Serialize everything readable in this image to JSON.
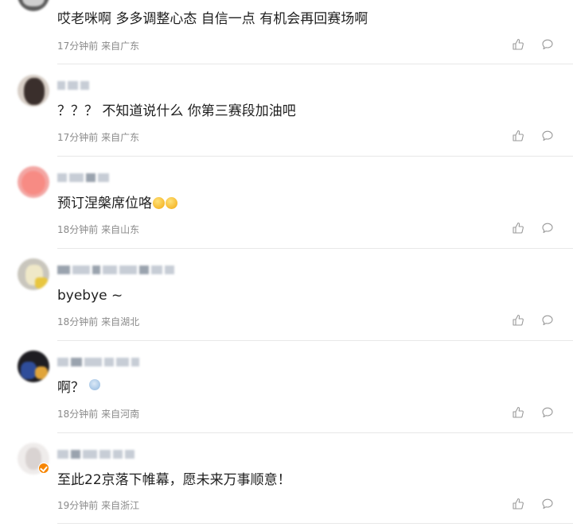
{
  "comments": [
    {
      "text": "哎老咪啊 多多调整心态 自信一点 有机会再回赛场啊",
      "time": "17分钟前",
      "location": "来自广东"
    },
    {
      "text": "？？？ 不知道说什么 你第三赛段加油吧",
      "time": "17分钟前",
      "location": "来自广东"
    },
    {
      "text": "预订涅槃席位咯",
      "time": "18分钟前",
      "location": "来自山东",
      "emoji": "flushed-face-emoji"
    },
    {
      "text": "byebye ~",
      "time": "18分钟前",
      "location": "来自湖北"
    },
    {
      "text": "啊？",
      "time": "18分钟前",
      "location": "来自河南",
      "emoji": "baby-angel-emoji"
    },
    {
      "text": "至此22京落下帷幕，愿未来万事顺意！",
      "time": "19分钟前",
      "location": "来自浙江",
      "verified_badge": true
    }
  ],
  "icons": {
    "like": "thumbs-up-icon",
    "reply": "comment-bubble-icon"
  },
  "colors": {
    "text": "#1f1f1f",
    "meta": "#8a8a8a",
    "divider": "#e8e8e8",
    "icon": "#9a9a9a",
    "verified_badge": "#f78500"
  }
}
